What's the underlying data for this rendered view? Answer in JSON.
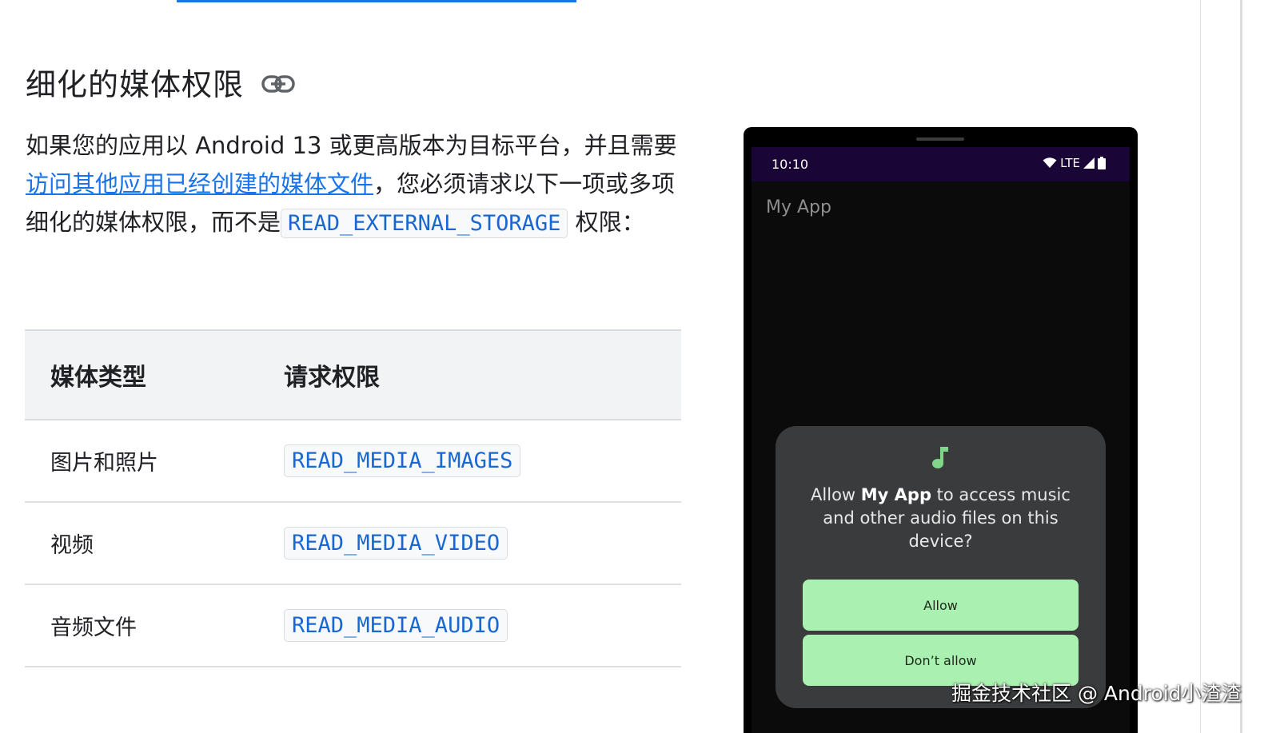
{
  "section": {
    "title": "细化的媒体权限",
    "link_icon": "link-icon"
  },
  "intro": {
    "part1": "如果您的应用以 Android 13 或更高版本为目标平台，并且需要",
    "link_text": "访问其他应用已经创建的媒体文件",
    "part2": "，您必须请求以下一项或多项细化的媒体权限，而不是",
    "legacy_permission": "READ_EXTERNAL_STORAGE",
    "part3": " 权限："
  },
  "table": {
    "headers": [
      "媒体类型",
      "请求权限"
    ],
    "rows": [
      {
        "media_type": "图片和照片",
        "permission": "READ_MEDIA_IMAGES"
      },
      {
        "media_type": "视频",
        "permission": "READ_MEDIA_VIDEO"
      },
      {
        "media_type": "音频文件",
        "permission": "READ_MEDIA_AUDIO"
      }
    ]
  },
  "phone": {
    "time": "10:10",
    "network": "LTE",
    "app_title": "My App",
    "dialog": {
      "icon": "music-note-icon",
      "msg_prefix": "Allow ",
      "msg_app": "My App",
      "msg_suffix": " to access music and other audio files on this device?",
      "allow_label": "Allow",
      "deny_label": "Don’t allow"
    }
  },
  "watermark": "掘金技术社区 @ Android小渣渣",
  "colors": {
    "link": "#1a73e8",
    "code": "#1967d2",
    "status_bar": "#1a0636",
    "dialog_bg": "#3a3b3c",
    "button_bg": "#aaf0b0",
    "music_icon": "#7fd88a"
  }
}
